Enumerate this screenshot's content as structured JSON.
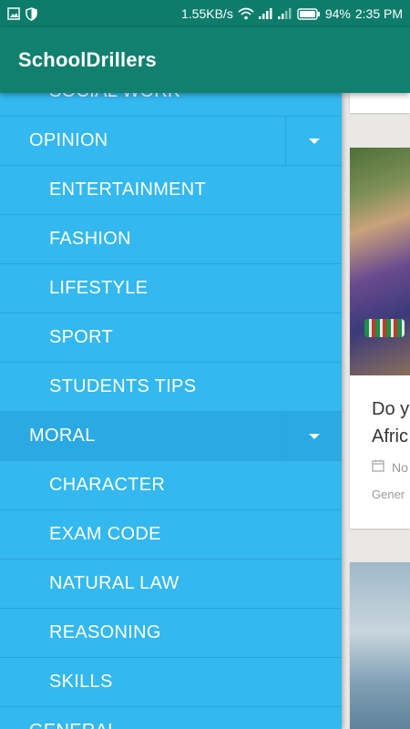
{
  "status_bar": {
    "net_speed": "1.55KB/s",
    "battery": "94%",
    "time": "2:35 PM",
    "icons": [
      "image-icon",
      "shield-icon",
      "wifi-icon",
      "signal-icon",
      "signal-icon",
      "battery-icon"
    ]
  },
  "app_bar": {
    "title": "SchoolDrillers"
  },
  "drawer": {
    "items": [
      {
        "label": "SOCIAL WORK",
        "level": "sub"
      },
      {
        "label": "OPINION",
        "level": "top",
        "expandable": true
      },
      {
        "label": "ENTERTAINMENT",
        "level": "sub"
      },
      {
        "label": "FASHION",
        "level": "sub"
      },
      {
        "label": "LIFESTYLE",
        "level": "sub"
      },
      {
        "label": "SPORT",
        "level": "sub"
      },
      {
        "label": "STUDENTS TIPS",
        "level": "sub"
      },
      {
        "label": "MORAL",
        "level": "top",
        "expandable": true,
        "active": true
      },
      {
        "label": "CHARACTER",
        "level": "sub"
      },
      {
        "label": "EXAM CODE",
        "level": "sub"
      },
      {
        "label": "NATURAL LAW",
        "level": "sub"
      },
      {
        "label": "REASONING",
        "level": "sub"
      },
      {
        "label": "SKILLS",
        "level": "sub"
      },
      {
        "label": "GENERAL",
        "level": "top"
      }
    ]
  },
  "content": {
    "card1": {
      "title_line1": "Do y",
      "title_line2": "Afric",
      "meta_date": "No",
      "meta_category": "Gener"
    }
  },
  "colors": {
    "status_bar": "#0e7c6b",
    "app_bar": "#12806e",
    "drawer_bg": "#33b8ef",
    "drawer_active": "#2aa9e3",
    "divider": "#2aa6da"
  }
}
